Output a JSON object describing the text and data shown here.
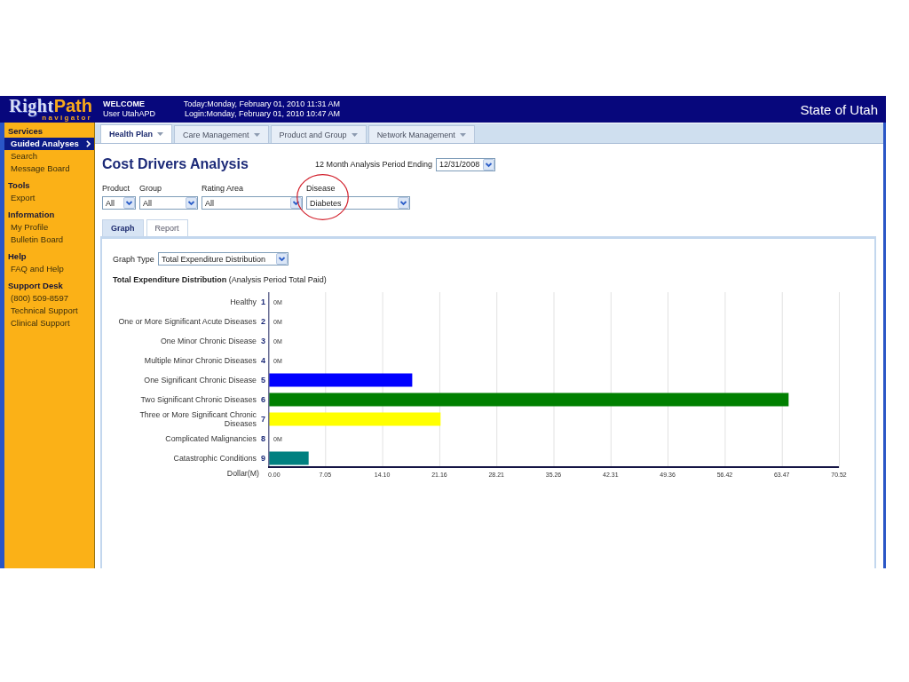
{
  "header": {
    "logo": {
      "name_parts": [
        "Right",
        "Path"
      ],
      "tagline": "navigator"
    },
    "welcome": "WELCOME",
    "user": "User UtahAPD",
    "today": "Today:Monday, February 01, 2010 11:31 AM",
    "login": "Login:Monday, February 01, 2010 10:47 AM",
    "organization": "State of Utah"
  },
  "sidebar": {
    "sections": [
      {
        "title": "Services",
        "items": [
          {
            "label": "Guided Analyses",
            "selected": true
          },
          {
            "label": "Search",
            "selected": false
          },
          {
            "label": "Message Board",
            "selected": false
          }
        ]
      },
      {
        "title": "Tools",
        "items": [
          {
            "label": "Export",
            "selected": false
          }
        ]
      },
      {
        "title": "Information",
        "items": [
          {
            "label": "My Profile",
            "selected": false
          },
          {
            "label": "Bulletin Board",
            "selected": false
          }
        ]
      },
      {
        "title": "Help",
        "items": [
          {
            "label": "FAQ and Help",
            "selected": false
          }
        ]
      },
      {
        "title": "Support Desk",
        "items": [
          {
            "label": "(800) 509-8597",
            "selected": false
          },
          {
            "label": "Technical Support",
            "selected": false
          },
          {
            "label": "Clinical Support",
            "selected": false
          }
        ]
      }
    ]
  },
  "tabs": [
    {
      "label": "Health Plan",
      "selected": true
    },
    {
      "label": "Care Management",
      "selected": false
    },
    {
      "label": "Product and Group",
      "selected": false
    },
    {
      "label": "Network Management",
      "selected": false
    }
  ],
  "title": "Cost Drivers Analysis",
  "period": {
    "label": "12 Month Analysis Period Ending",
    "value": "12/31/2008"
  },
  "filters": [
    {
      "label": "Product",
      "value": "All",
      "circled": false
    },
    {
      "label": "Group",
      "value": "All",
      "circled": false
    },
    {
      "label": "Rating Area",
      "value": "All",
      "circled": false
    },
    {
      "label": "Disease",
      "value": "Diabetes",
      "circled": true
    }
  ],
  "subtabs": [
    {
      "label": "Graph",
      "selected": true
    },
    {
      "label": "Report",
      "selected": false
    }
  ],
  "graph": {
    "type_label": "Graph Type",
    "type_value": "Total Expenditure Distribution",
    "row_numbers": [
      "1",
      "2",
      "3",
      "4",
      "5",
      "6",
      "7",
      "8",
      "9"
    ],
    "chart_data": {
      "type": "bar",
      "orientation": "horizontal",
      "grid": true,
      "title": "**Total Expenditure Distribution** (Analysis Period Total Paid)",
      "xlabel": "Dollar(M)",
      "categories": [
        "Healthy",
        "One or More Significant Acute Diseases",
        "One Minor Chronic Disease",
        "Multiple Minor Chronic Diseases",
        "One Significant Chronic Disease",
        "Two Significant Chronic Diseases",
        "Three or More Significant Chronic Diseases",
        "Complicated Malignancies",
        "Catastrophic Conditions"
      ],
      "values": [
        0,
        0,
        0,
        0,
        17.7,
        64.2,
        21.2,
        0,
        4.9
      ],
      "colors": [
        null,
        null,
        null,
        null,
        "#0000ff",
        "#008000",
        "#ffff00",
        null,
        "#008080"
      ],
      "value_labels": [
        "0M",
        "0M",
        "0M",
        "0M",
        null,
        null,
        null,
        "0M",
        null
      ],
      "xlim": [
        0,
        70.52
      ],
      "xticks": [
        {
          "value": 0,
          "label": "0.00"
        },
        {
          "value": 7.05,
          "label": "7.05"
        },
        {
          "value": 14.1,
          "label": "14.10"
        },
        {
          "value": 21.16,
          "label": "21.16"
        },
        {
          "value": 28.21,
          "label": "28.21"
        },
        {
          "value": 35.26,
          "label": "35.26"
        },
        {
          "value": 42.31,
          "label": "42.31"
        },
        {
          "value": 49.36,
          "label": "49.36"
        },
        {
          "value": 56.42,
          "label": "56.42"
        },
        {
          "value": 63.47,
          "label": "63.47"
        },
        {
          "value": 70.52,
          "label": "70.52"
        }
      ]
    }
  }
}
